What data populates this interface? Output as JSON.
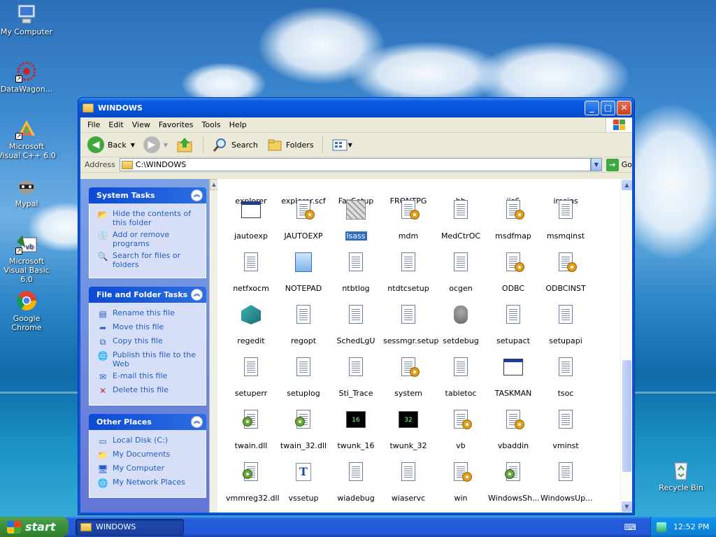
{
  "desktop": {
    "icons": [
      {
        "label": "My Computer"
      },
      {
        "label": "DataWagon..."
      },
      {
        "label": "Microsoft Visual C++ 6.0"
      },
      {
        "label": "Mypal"
      },
      {
        "label": "Microsoft Visual Basic 6.0"
      },
      {
        "label": "Google Chrome"
      },
      {
        "label": "Recycle Bin"
      }
    ]
  },
  "window": {
    "title": "WINDOWS",
    "menu": [
      "File",
      "Edit",
      "View",
      "Favorites",
      "Tools",
      "Help"
    ],
    "toolbar": {
      "back": "Back",
      "search": "Search",
      "folders": "Folders"
    },
    "address": {
      "label": "Address",
      "value": "C:\\WINDOWS",
      "go": "Go"
    }
  },
  "taskpane": {
    "system_tasks": {
      "title": "System Tasks",
      "items": [
        "Hide the contents of this folder",
        "Add or remove programs",
        "Search for files or folders"
      ]
    },
    "file_tasks": {
      "title": "File and Folder Tasks",
      "items": [
        "Rename this file",
        "Move this file",
        "Copy this file",
        "Publish this file to the Web",
        "E-mail this file",
        "Delete this file"
      ]
    },
    "other_places": {
      "title": "Other Places",
      "items": [
        "Local Disk (C:)",
        "My Documents",
        "My Computer",
        "My Network Places"
      ]
    }
  },
  "files": [
    {
      "name": "explorer",
      "icon": "exe-icon"
    },
    {
      "name": "explorer.scf",
      "icon": "document-icon"
    },
    {
      "name": "FaxSetup",
      "icon": "document-icon"
    },
    {
      "name": "FRONTPG",
      "icon": "document-icon"
    },
    {
      "name": "hh",
      "icon": "exe-icon"
    },
    {
      "name": "iis6",
      "icon": "document-icon"
    },
    {
      "name": "imsins",
      "icon": "document-icon"
    },
    {
      "name": "jautoexp",
      "icon": "exe-icon"
    },
    {
      "name": "JAUTOEXP",
      "icon": "settings-file-icon"
    },
    {
      "name": "lsass",
      "icon": "lsass-icon",
      "selected": true
    },
    {
      "name": "mdm",
      "icon": "settings-file-icon"
    },
    {
      "name": "MedCtrOC",
      "icon": "document-icon"
    },
    {
      "name": "msdfmap",
      "icon": "settings-file-icon"
    },
    {
      "name": "msmqinst",
      "icon": "document-icon"
    },
    {
      "name": "netfxocm",
      "icon": "document-icon"
    },
    {
      "name": "NOTEPAD",
      "icon": "notepad-icon"
    },
    {
      "name": "ntbtlog",
      "icon": "document-icon"
    },
    {
      "name": "ntdtcsetup",
      "icon": "document-icon"
    },
    {
      "name": "ocgen",
      "icon": "document-icon"
    },
    {
      "name": "ODBC",
      "icon": "settings-file-icon"
    },
    {
      "name": "ODBCINST",
      "icon": "settings-file-icon"
    },
    {
      "name": "regedit",
      "icon": "regedit-icon"
    },
    {
      "name": "regopt",
      "icon": "document-icon"
    },
    {
      "name": "SchedLgU",
      "icon": "document-icon"
    },
    {
      "name": "sessmgr.setup",
      "icon": "document-icon"
    },
    {
      "name": "setdebug",
      "icon": "bear-icon"
    },
    {
      "name": "setupact",
      "icon": "document-icon"
    },
    {
      "name": "setupapi",
      "icon": "document-icon"
    },
    {
      "name": "setuperr",
      "icon": "document-icon"
    },
    {
      "name": "setuplog",
      "icon": "document-icon"
    },
    {
      "name": "Sti_Trace",
      "icon": "document-icon"
    },
    {
      "name": "system",
      "icon": "settings-file-icon"
    },
    {
      "name": "tabletoc",
      "icon": "document-icon"
    },
    {
      "name": "TASKMAN",
      "icon": "exe-icon"
    },
    {
      "name": "tsoc",
      "icon": "document-icon"
    },
    {
      "name": "twain.dll",
      "icon": "dll-icon"
    },
    {
      "name": "twain_32.dll",
      "icon": "dll-icon"
    },
    {
      "name": "twunk_16",
      "icon": "binary-exe-icon",
      "badge": "16"
    },
    {
      "name": "twunk_32",
      "icon": "binary-exe-icon",
      "badge": "32"
    },
    {
      "name": "vb",
      "icon": "settings-file-icon"
    },
    {
      "name": "vbaddin",
      "icon": "settings-file-icon"
    },
    {
      "name": "vminst",
      "icon": "document-icon"
    },
    {
      "name": "vmmreg32.dll",
      "icon": "dll-icon"
    },
    {
      "name": "vssetup",
      "icon": "font-icon"
    },
    {
      "name": "wiadebug",
      "icon": "document-icon"
    },
    {
      "name": "wiaservc",
      "icon": "document-icon"
    },
    {
      "name": "win",
      "icon": "settings-file-icon"
    },
    {
      "name": "WindowsSh...",
      "icon": "dll-icon"
    },
    {
      "name": "WindowsUp...",
      "icon": "document-icon"
    }
  ],
  "taskbar": {
    "start": "start",
    "task": "WINDOWS",
    "clock": "12:52 PM"
  }
}
